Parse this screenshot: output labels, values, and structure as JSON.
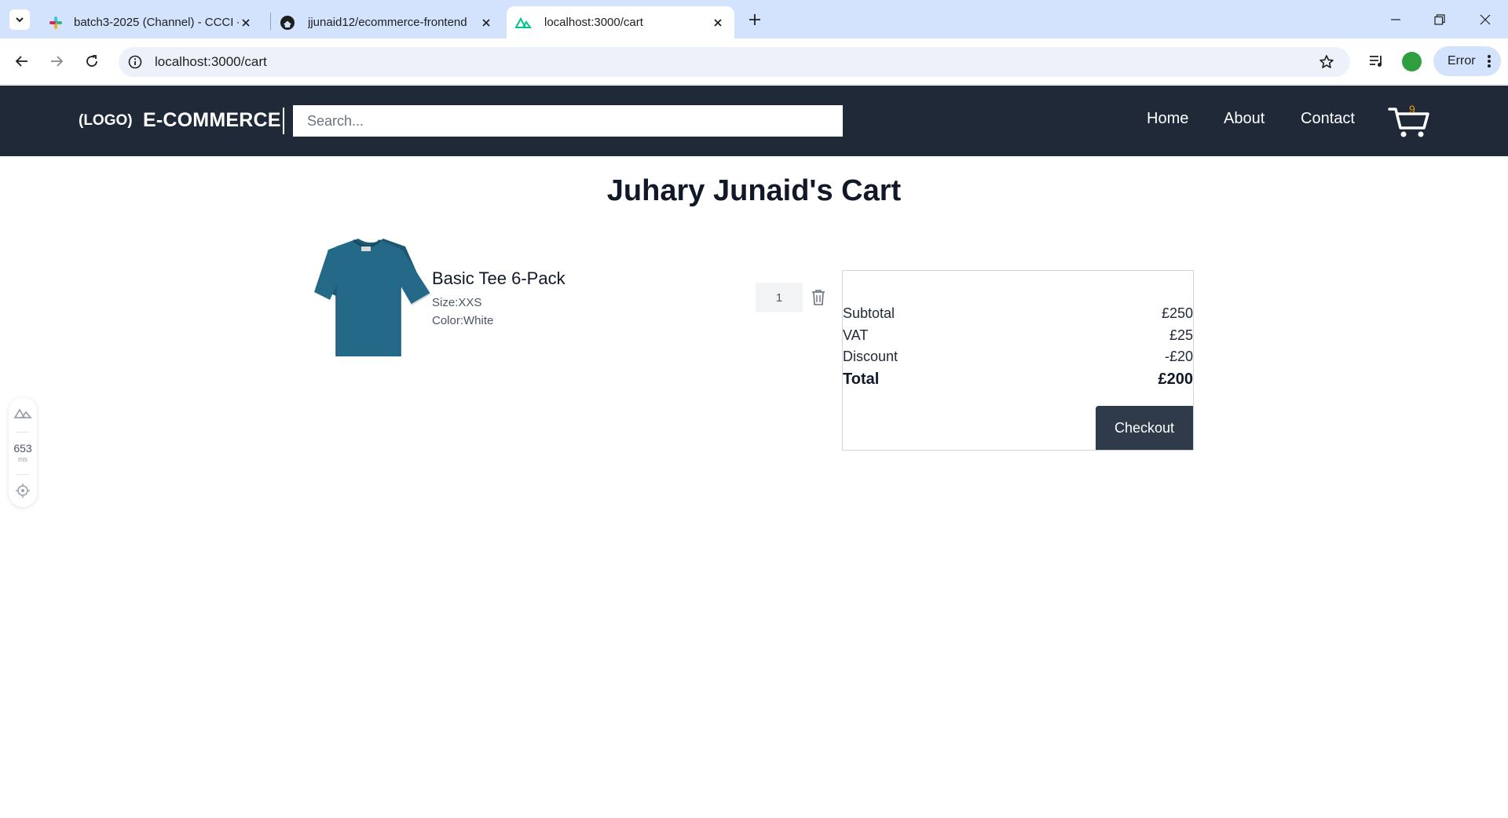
{
  "browser": {
    "tabs": [
      {
        "title": "batch3-2025 (Channel) - CCCI -",
        "icon": "slack-icon",
        "active": false
      },
      {
        "title": "jjunaid12/ecommerce-frontend",
        "icon": "github-icon",
        "active": false
      },
      {
        "title": "localhost:3000/cart",
        "icon": "nuxt-icon",
        "active": true
      }
    ],
    "url": "localhost:3000/cart",
    "error_label": "Error"
  },
  "header": {
    "logo": "(LOGO)",
    "brand": "E-COMMERCE",
    "search_placeholder": "Search...",
    "nav": [
      {
        "label": "Home"
      },
      {
        "label": "About"
      },
      {
        "label": "Contact"
      }
    ],
    "cart_count": "9"
  },
  "page": {
    "title": "Juhary Junaid's Cart"
  },
  "cart": {
    "items": [
      {
        "name": "Basic Tee 6-Pack",
        "size": "Size:XXS",
        "color": "Color:White",
        "quantity": "1",
        "image": "teal-tshirt-image"
      }
    ]
  },
  "summary": {
    "rows": [
      {
        "label": "Subtotal",
        "value": "£250"
      },
      {
        "label": "VAT",
        "value": "£25"
      },
      {
        "label": "Discount",
        "value": "-£20"
      }
    ],
    "total_label": "Total",
    "total_value": "£200",
    "checkout_label": "Checkout"
  },
  "devtools": {
    "ms_value": "653",
    "ms_unit": "ms"
  },
  "colors": {
    "header_bg": "#1f2937",
    "checkout_bg": "#2f3a4b",
    "cart_badge": "#f59e0b",
    "tabstrip_bg": "#d3e3fd"
  }
}
